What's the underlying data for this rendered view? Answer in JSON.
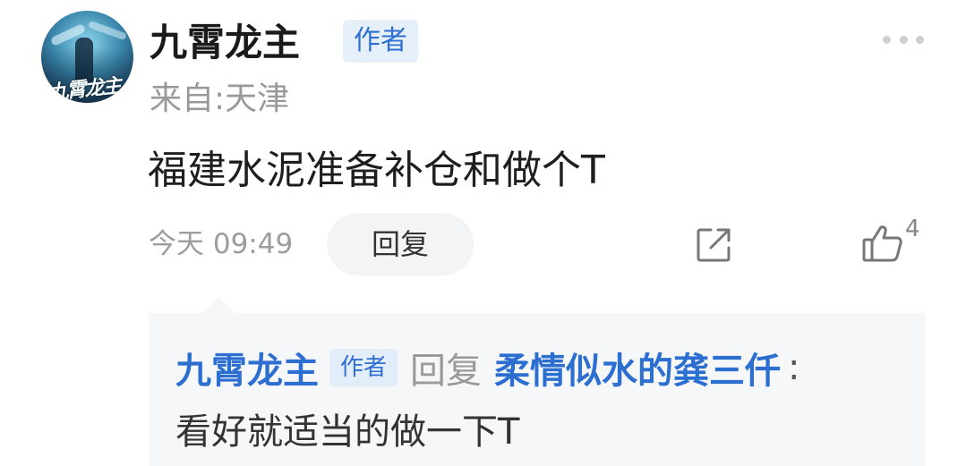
{
  "post": {
    "avatar_text": "九霄龙主",
    "author": "九霄龙主",
    "author_badge": "作者",
    "location": "来自:天津",
    "content": "福建水泥准备补仓和做个T",
    "time": "今天 09:49",
    "reply_label": "回复",
    "like_count": "4",
    "icons": {
      "more": "more-dots-icon",
      "share": "share-icon",
      "like": "thumbs-up-icon"
    }
  },
  "reply": {
    "author": "九霄龙主",
    "author_badge": "作者",
    "reply_word": "回复",
    "target": "柔情似水的龚三仟",
    "colon": ":",
    "text": "看好就适当的做一下T"
  },
  "colors": {
    "link_blue": "#2c6fd0",
    "badge_bg": "#e6f0fb",
    "reply_bg": "#f6f7f8"
  }
}
